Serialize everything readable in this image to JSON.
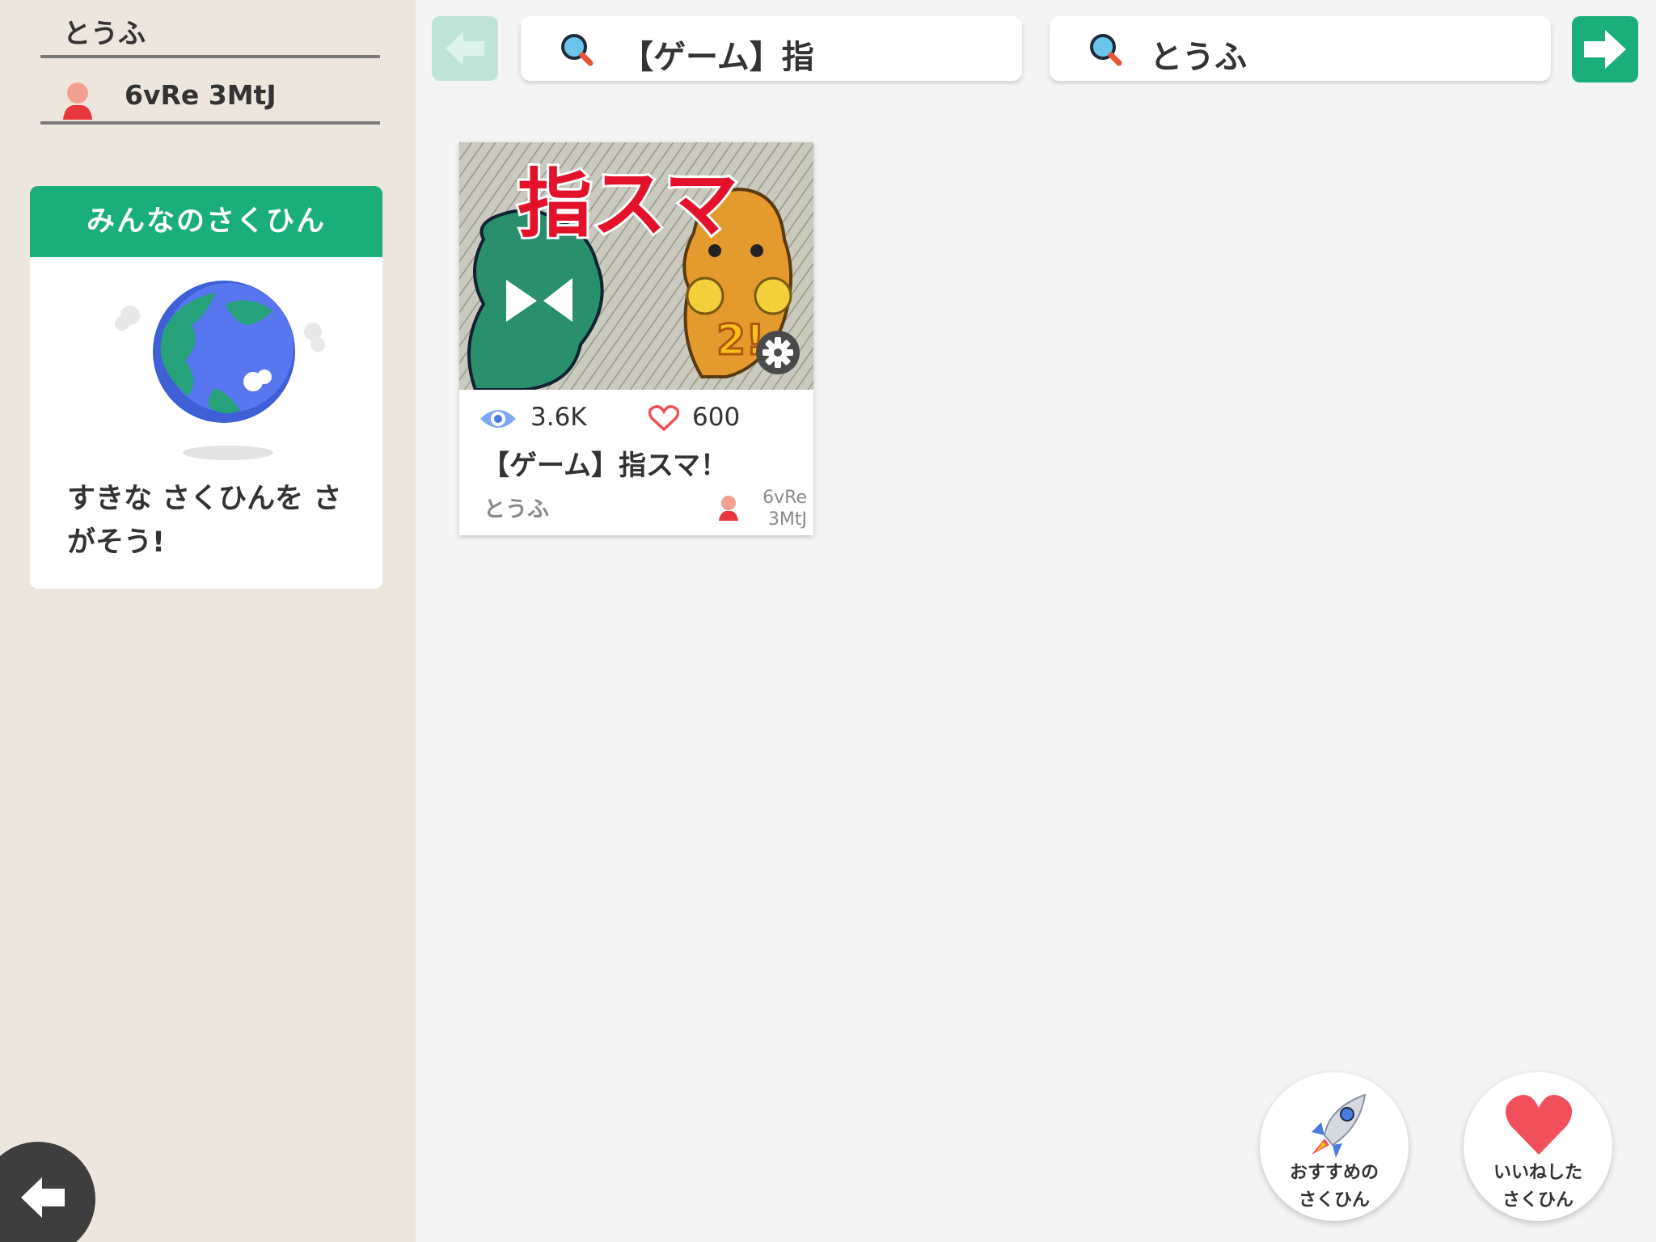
{
  "sidebar": {
    "group_name": "とうふ",
    "user_name": "6vRe 3MtJ",
    "world_card": {
      "header": "みんなのさくひん",
      "message": "すきな さくひんを さがそう!"
    }
  },
  "toolbar": {
    "search_title": "【ゲーム】指",
    "search_user": "とうふ"
  },
  "project": {
    "views": "3.6K",
    "likes": "600",
    "title": "【ゲーム】指スマ！",
    "group": "とうふ",
    "author_line1": "6vRe",
    "author_line2": "3MtJ",
    "thumbnail_text": "指スマ",
    "thumbnail_badge": "2!"
  },
  "bottom": {
    "recommend_label_1": "おすすめの",
    "recommend_label_2": "さくひん",
    "liked_label_1": "いいねした",
    "liked_label_2": "さくひん"
  },
  "colors": {
    "accent_green": "#1aae7a",
    "disabled_green": "#bfe5d8",
    "sidebar_bg": "#ede6dc",
    "heart_red": "#f0505a"
  },
  "icons": [
    "user-icon",
    "globe-icon",
    "search-icon",
    "arrow-left-icon",
    "arrow-right-icon",
    "eye-icon",
    "heart-icon",
    "gear-icon",
    "rocket-icon"
  ]
}
